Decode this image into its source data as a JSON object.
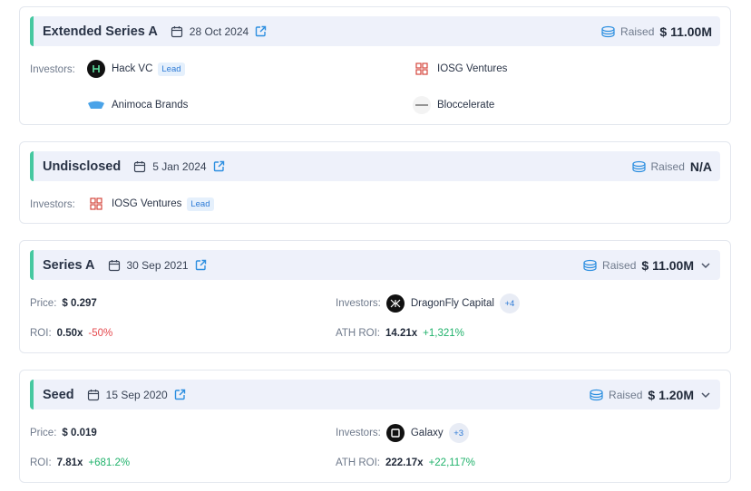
{
  "labels": {
    "investors": "Investors:",
    "raised": "Raised",
    "price": "Price:",
    "roi": "ROI:",
    "ath_roi": "ATH ROI:",
    "lead": "Lead"
  },
  "rounds": [
    {
      "name": "Extended Series A",
      "date": "28 Oct 2024",
      "raised": "$ 11.00M",
      "investors": [
        "Hack VC",
        "IOSG Ventures",
        "Animoca Brands",
        "Bloccelerate"
      ]
    },
    {
      "name": "Undisclosed",
      "date": "5 Jan 2024",
      "raised": "N/A",
      "investors": [
        "IOSG Ventures"
      ]
    },
    {
      "name": "Series A",
      "date": "30 Sep 2021",
      "raised": "$ 11.00M",
      "price": "$ 0.297",
      "roi": "0.50x",
      "roi_change": "-50%",
      "ath_roi": "14.21x",
      "ath_roi_change": "+1,321%",
      "investors": [
        "DragonFly Capital"
      ],
      "more_investors": "+4"
    },
    {
      "name": "Seed",
      "date": "15 Sep 2020",
      "raised": "$ 1.20M",
      "price": "$ 0.019",
      "roi": "7.81x",
      "roi_change": "+681.2%",
      "ath_roi": "222.17x",
      "ath_roi_change": "+22,117%",
      "investors": [
        "Galaxy"
      ],
      "more_investors": "+3"
    }
  ],
  "colors": {
    "accent": "#46c8a0",
    "link": "#2d7ad6",
    "positive": "#20b26b",
    "negative": "#e5484d"
  }
}
